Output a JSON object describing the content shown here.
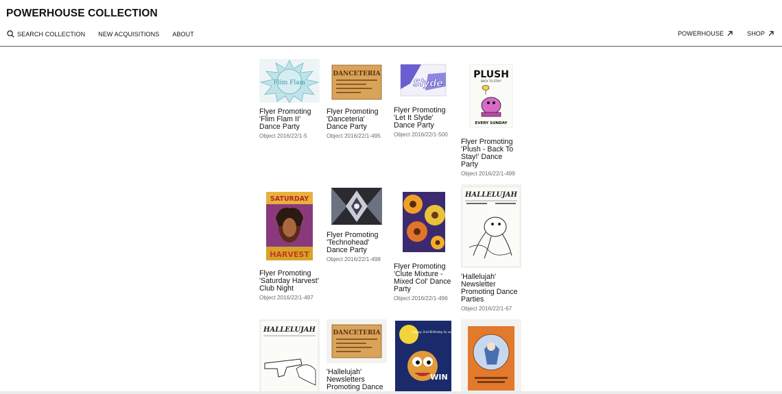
{
  "header": {
    "site_title": "POWERHOUSE COLLECTION",
    "nav_left": [
      {
        "label": "SEARCH COLLECTION",
        "icon": "search-icon"
      },
      {
        "label": "NEW ACQUISITIONS"
      },
      {
        "label": "ABOUT"
      }
    ],
    "nav_right": [
      {
        "label": "POWERHOUSE",
        "icon": "arrow-up-right-icon"
      },
      {
        "label": "SHOP",
        "icon": "arrow-up-right-icon"
      }
    ]
  },
  "results": [
    {
      "title": "Flyer Promoting 'Flim Flam II' Dance Party",
      "object_id": "Object 2016/22/1-5"
    },
    {
      "title": "Flyer Promoting 'Danceteria' Dance Party",
      "object_id": "Object 2016/22/1-495"
    },
    {
      "title": "Flyer Promoting 'Let It Slyde' Dance Party",
      "object_id": "Object 2016/22/1-500"
    },
    {
      "title": "Flyer Promoting 'Plush - Back To Stay!' Dance Party",
      "object_id": "Object 2016/22/1-499"
    },
    {
      "title": "Flyer Promoting 'Saturday Harvest' Club Night",
      "object_id": "Object 2016/22/1-497"
    },
    {
      "title": "Flyer Promoting 'Technohead' Dance Party",
      "object_id": "Object 2016/22/1-498"
    },
    {
      "title": "Flyer Promoting 'Clute Mixture - Mixed Col' Dance Party",
      "object_id": "Object 2016/22/1-496"
    },
    {
      "title": "'Hallelujah' Newsletter Promoting Dance Parties",
      "object_id": "Object 2016/22/1-67"
    },
    {
      "title": "",
      "object_id": ""
    },
    {
      "title": "'Hallelujah' Newsletters Promoting Dance Parties",
      "object_id": ""
    },
    {
      "title": "",
      "object_id": ""
    },
    {
      "title": "",
      "object_id": ""
    }
  ],
  "thumb_text": {
    "flim_flam": "Flim Flam",
    "danceteria": "DANCETERIA",
    "slyde": "Slyde",
    "plush": "PLUSH",
    "plush_sub": "BACK TO STAY!",
    "plush_footer": "EVERY SUNDAY",
    "saturday": "SATURDAY",
    "harvest": "HARVEST",
    "hallelujah": "HALLELUJAH",
    "birthday": "Happy 2nd Birthday to us!",
    "win": "WIN"
  },
  "colors": {
    "text": "#111111",
    "meta": "#6a6a6a",
    "rule": "#5b5b5b"
  }
}
